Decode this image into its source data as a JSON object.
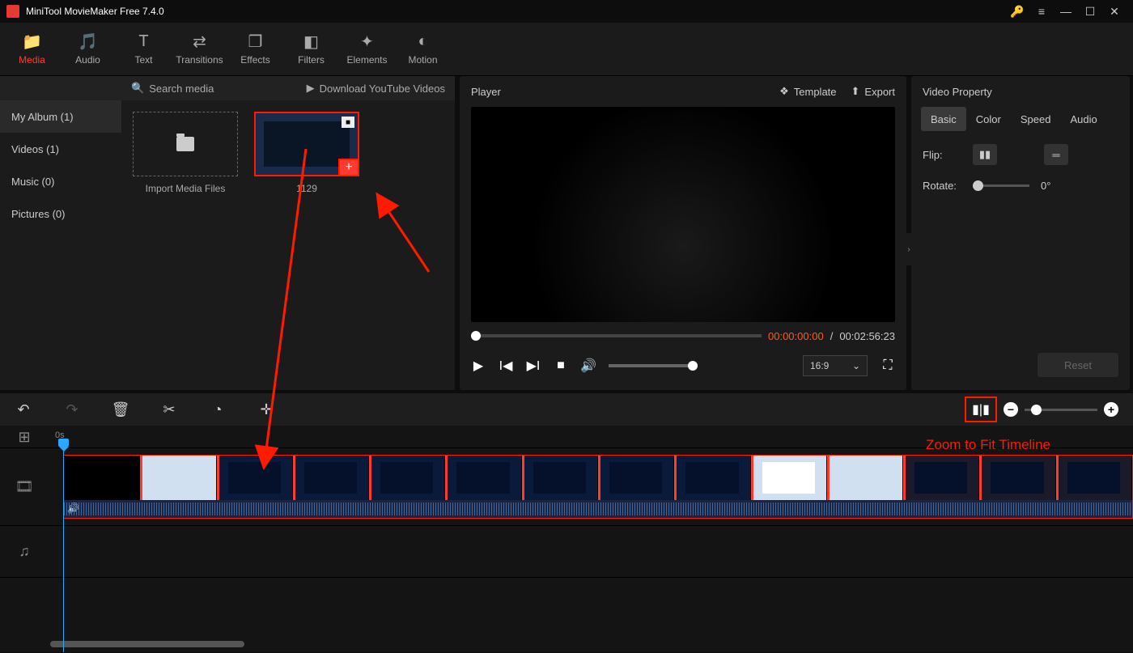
{
  "titlebar": {
    "title": "MiniTool MovieMaker Free 7.4.0"
  },
  "maintabs": [
    {
      "label": "Media",
      "icon": "📁",
      "active": true
    },
    {
      "label": "Audio",
      "icon": "🎵"
    },
    {
      "label": "Text",
      "icon": "T"
    },
    {
      "label": "Transitions",
      "icon": "⇄"
    },
    {
      "label": "Effects",
      "icon": "❐"
    },
    {
      "label": "Filters",
      "icon": "◧"
    },
    {
      "label": "Elements",
      "icon": "✦"
    },
    {
      "label": "Motion",
      "icon": "◐"
    }
  ],
  "mediabar": {
    "search_ph": "Search media",
    "download": "Download YouTube Videos"
  },
  "sidebar": {
    "album": "My Album (1)",
    "videos": "Videos (1)",
    "music": "Music (0)",
    "pictures": "Pictures (0)"
  },
  "mediagrid": {
    "import": "Import Media Files",
    "clip1": "1129"
  },
  "player": {
    "title": "Player",
    "template": "Template",
    "export": "Export",
    "current": "00:00:00:00",
    "sep": " / ",
    "total": "00:02:56:23",
    "aspect": "16:9"
  },
  "props": {
    "title": "Video Property",
    "tabs": {
      "basic": "Basic",
      "color": "Color",
      "speed": "Speed",
      "audio": "Audio"
    },
    "flip": "Flip:",
    "rotate": "Rotate:",
    "rotate_v": "0°",
    "reset": "Reset"
  },
  "timeline": {
    "zero": "0s",
    "annot": "Zoom to Fit Timeline"
  }
}
